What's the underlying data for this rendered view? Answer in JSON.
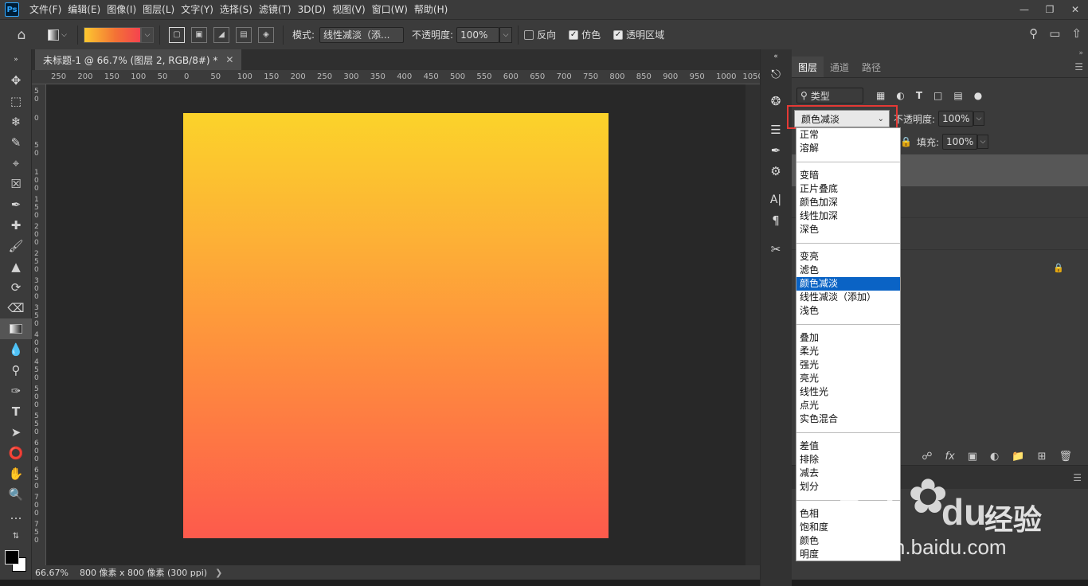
{
  "menubar": {
    "logo": "Ps",
    "items": [
      "文件(F)",
      "编辑(E)",
      "图像(I)",
      "图层(L)",
      "文字(Y)",
      "选择(S)",
      "滤镜(T)",
      "3D(D)",
      "视图(V)",
      "窗口(W)",
      "帮助(H)"
    ]
  },
  "options": {
    "mode_label": "模式:",
    "mode_value": "线性减淡（添...",
    "opacity_label": "不透明度:",
    "opacity_value": "100%",
    "reverse_label": "反向",
    "dither_label": "仿色",
    "transparency_label": "透明区域",
    "gradient_colors": [
      "#fdc830",
      "#f37335",
      "#f5434f"
    ]
  },
  "document": {
    "tab_title": "未标题-1 @ 66.7% (图层 2, RGB/8#) *",
    "zoom": "66.67%",
    "info": "800 像素 x 800 像素 (300 ppi)",
    "gradient_colors": [
      "#fbd32a",
      "#fd5a4c"
    ]
  },
  "ruler_top": [
    "250",
    "200",
    "150",
    "100",
    "50",
    "0",
    "50",
    "100",
    "150",
    "200",
    "250",
    "300",
    "350",
    "400",
    "450",
    "500",
    "550",
    "600",
    "650",
    "700",
    "750",
    "800",
    "850",
    "900",
    "950",
    "1000",
    "1050"
  ],
  "ruler_left": [
    "5 0",
    "0",
    "5 0",
    "1 0 0",
    "1 5 0",
    "2 0 0",
    "2 5 0",
    "3 0 0",
    "3 5 0",
    "4 0 0",
    "4 5 0",
    "5 0 0",
    "5 5 0",
    "6 0 0",
    "6 5 0",
    "7 0 0",
    "7 5 0"
  ],
  "layers_panel": {
    "tabs": [
      "图层",
      "通道",
      "路径"
    ],
    "filter_kind": "类型",
    "blend_mode": "颜色减淡",
    "opacity_label": "不透明度:",
    "opacity_value": "100%",
    "fill_label": "填充:",
    "fill_value": "100%"
  },
  "blend_dropdown": {
    "groups": [
      [
        "正常",
        "溶解"
      ],
      [
        "变暗",
        "正片叠底",
        "颜色加深",
        "线性加深",
        "深色"
      ],
      [
        "变亮",
        "滤色",
        "颜色减淡",
        "线性减淡（添加）",
        "浅色"
      ],
      [
        "叠加",
        "柔光",
        "强光",
        "亮光",
        "线性光",
        "点光",
        "实色混合"
      ],
      [
        "差值",
        "排除",
        "减去",
        "划分"
      ],
      [
        "色相",
        "饱和度",
        "颜色",
        "明度"
      ]
    ],
    "selected": "颜色减淡"
  },
  "watermark": {
    "brand": "Bai",
    "brand2": "du",
    "cn": "经验",
    "url": "jingyan.baidu.com"
  },
  "colors": {
    "highlight_border": "#e53935",
    "selected_option": "#0a63c5"
  }
}
